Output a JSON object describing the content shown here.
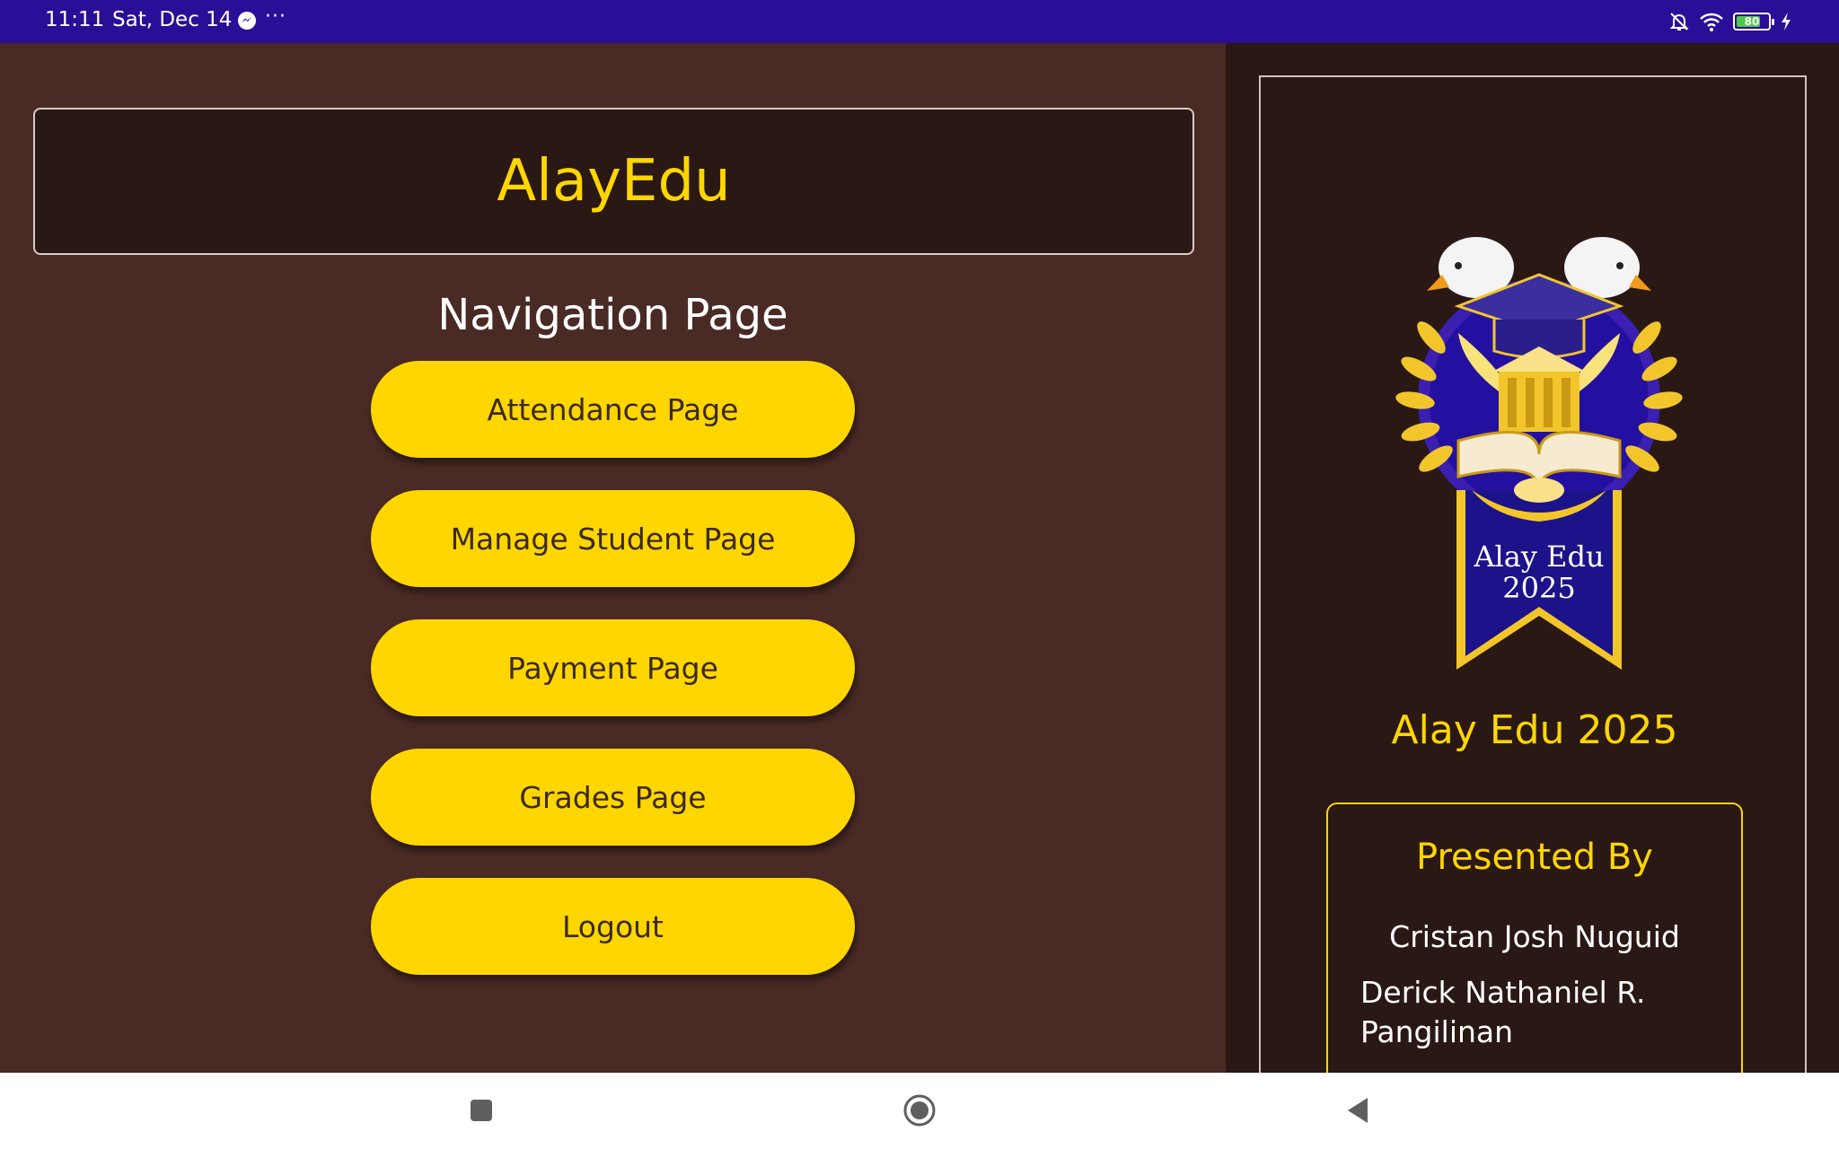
{
  "status_bar": {
    "time": "11:11",
    "date": "Sat, Dec 14",
    "more": "···",
    "battery_level": "80",
    "icons": [
      "messenger-icon",
      "bell-off-icon",
      "wifi-icon",
      "battery-icon",
      "charging-icon"
    ]
  },
  "header": {
    "app_title": "AlayEdu"
  },
  "navigation": {
    "heading": "Navigation Page",
    "buttons": [
      {
        "label": "Attendance Page"
      },
      {
        "label": "Manage Student Page"
      },
      {
        "label": "Payment Page"
      },
      {
        "label": "Grades Page"
      },
      {
        "label": "Logout"
      }
    ]
  },
  "side_panel": {
    "logo_text": {
      "line1": "Alay Edu",
      "line2": "2025"
    },
    "caption": "Alay Edu 2025",
    "presented_by": {
      "heading": "Presented By",
      "names": [
        "Cristan Josh Nuguid",
        "Derick Nathaniel R. Pangilinan"
      ]
    }
  },
  "system_nav": {
    "buttons": [
      "recents-button",
      "home-button",
      "back-button"
    ]
  },
  "colors": {
    "status_bar": "#2b0e97",
    "left_background": "#4a2a25",
    "panel_background": "#2a1814",
    "accent_yellow": "#ffd600",
    "button_text": "#3b2a22"
  }
}
